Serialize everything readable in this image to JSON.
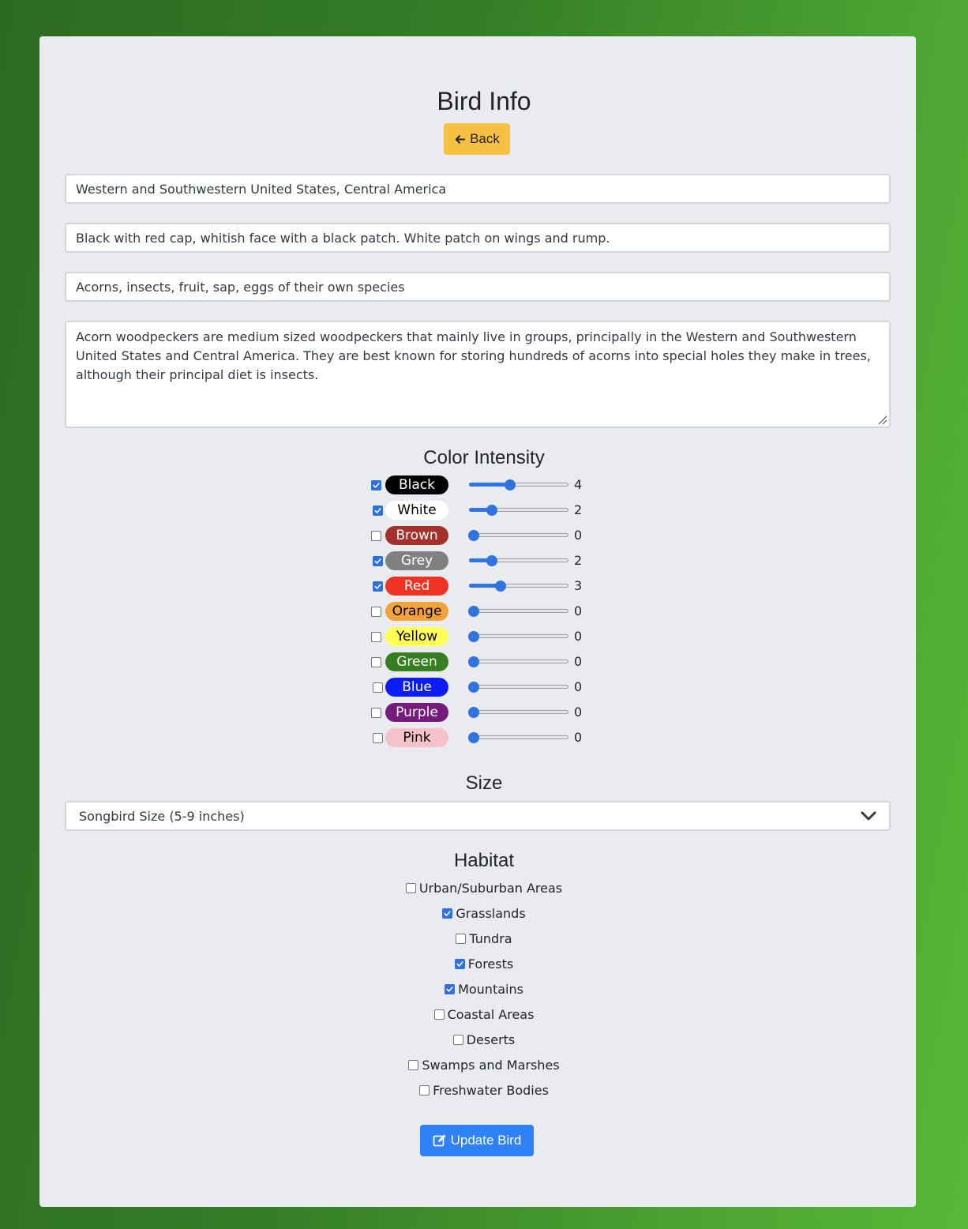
{
  "page": {
    "title": "Bird Info",
    "back_label": "Back",
    "update_label": "Update Bird"
  },
  "fields": {
    "range": "Western and Southwestern United States, Central America",
    "appearance": "Black with red cap, whitish face with a black patch. White patch on wings and rump.",
    "diet": "Acorns, insects, fruit, sap, eggs of their own species",
    "description": "Acorn woodpeckers are medium sized woodpeckers that mainly live in groups, principally in the Western and Southwestern United States and Central America. They are best known for storing hundreds of acorns into special holes they make in trees, although their principal diet is insects."
  },
  "color_intensity": {
    "heading": "Color Intensity",
    "slider_max": 10,
    "colors": [
      {
        "label": "Black",
        "checked": true,
        "value": "4",
        "bg": "#000000",
        "fg": "#ffffff"
      },
      {
        "label": "White",
        "checked": true,
        "value": "2",
        "bg": "#ffffff",
        "fg": "#000000"
      },
      {
        "label": "Brown",
        "checked": false,
        "value": "0",
        "bg": "#a5312c",
        "fg": "#ffffff"
      },
      {
        "label": "Grey",
        "checked": true,
        "value": "2",
        "bg": "#808080",
        "fg": "#ffffff"
      },
      {
        "label": "Red",
        "checked": true,
        "value": "3",
        "bg": "#ee3323",
        "fg": "#ffffff"
      },
      {
        "label": "Orange",
        "checked": false,
        "value": "0",
        "bg": "#f2a23b",
        "fg": "#000000"
      },
      {
        "label": "Yellow",
        "checked": false,
        "value": "0",
        "bg": "#ffff54",
        "fg": "#000000"
      },
      {
        "label": "Green",
        "checked": false,
        "value": "0",
        "bg": "#377d22",
        "fg": "#ffffff"
      },
      {
        "label": "Blue",
        "checked": false,
        "value": "0",
        "bg": "#0c1cf5",
        "fg": "#ffffff"
      },
      {
        "label": "Purple",
        "checked": false,
        "value": "0",
        "bg": "#741b7c",
        "fg": "#ffffff"
      },
      {
        "label": "Pink",
        "checked": false,
        "value": "0",
        "bg": "#f5c2cb",
        "fg": "#000000"
      }
    ]
  },
  "size": {
    "heading": "Size",
    "selected": "Songbird Size (5-9 inches)"
  },
  "habitat": {
    "heading": "Habitat",
    "options": [
      {
        "label": "Urban/Suburban Areas",
        "checked": false
      },
      {
        "label": "Grasslands",
        "checked": true
      },
      {
        "label": "Tundra",
        "checked": false
      },
      {
        "label": "Forests",
        "checked": true
      },
      {
        "label": "Mountains",
        "checked": true
      },
      {
        "label": "Coastal Areas",
        "checked": false
      },
      {
        "label": "Deserts",
        "checked": false
      },
      {
        "label": "Swamps and Marshes",
        "checked": false
      },
      {
        "label": "Freshwater Bodies",
        "checked": false
      }
    ]
  },
  "icons": {
    "back": "arrow-left-icon",
    "update": "edit-icon",
    "select": "chevron-down-icon"
  },
  "theme": {
    "accent": "#2f72e0",
    "warning": "#f6c042",
    "primary": "#2f81f7"
  }
}
